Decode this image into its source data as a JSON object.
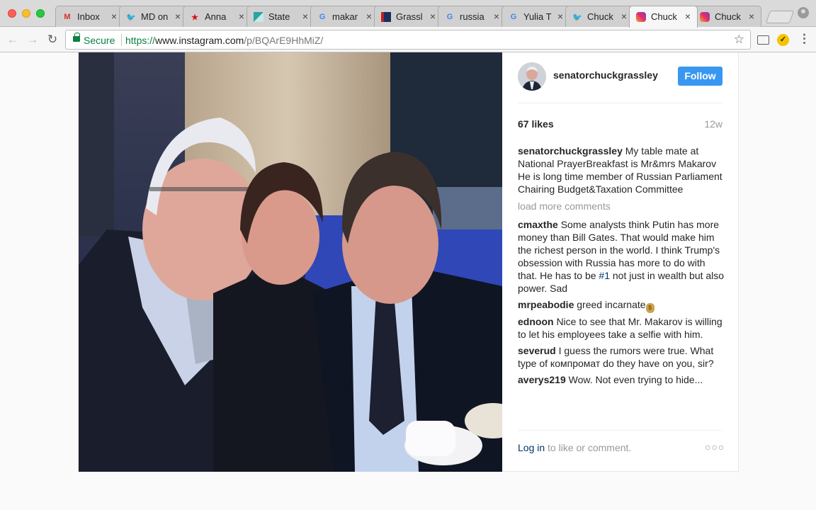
{
  "browser": {
    "tabs": [
      {
        "label": "Inbox",
        "icon": "gmail-icon",
        "active": false
      },
      {
        "label": "MD on",
        "icon": "twitter-icon",
        "active": false
      },
      {
        "label": "Anna",
        "icon": "red-star-icon",
        "active": false
      },
      {
        "label": "State",
        "icon": "state-site-icon",
        "active": false
      },
      {
        "label": "makar",
        "icon": "google-icon",
        "active": false
      },
      {
        "label": "Grassl",
        "icon": "news-site-icon",
        "active": false
      },
      {
        "label": "russia",
        "icon": "google-icon",
        "active": false
      },
      {
        "label": "Yulia T",
        "icon": "google-icon",
        "active": false
      },
      {
        "label": "Chuck",
        "icon": "twitter-icon",
        "active": false
      },
      {
        "label": "Chuck",
        "icon": "instagram-icon",
        "active": true
      },
      {
        "label": "Chuck",
        "icon": "instagram-icon",
        "active": false
      }
    ],
    "secure_label": "Secure",
    "url_scheme": "https://",
    "url_host": "www.instagram.com",
    "url_path": "/p/BQArE9HhMiZ/"
  },
  "post": {
    "username": "senatorchuckgrassley",
    "follow_label": "Follow",
    "likes": "67 likes",
    "age": "12w",
    "caption_user": "senatorchuckgrassley",
    "caption_text": "My table mate at National PrayerBreakfast is Mr&mrs Makarov He is long time member of Russian Parliament Chairing Budget&Taxation Committee",
    "load_more": "load more comments",
    "comments": [
      {
        "user": "cmaxthe",
        "text_before": "Some analysts think Putin has more money than Bill Gates. That would make him the richest person in the world. I think Trump's obsession with Russia has more to do with that. He has to be ",
        "hashtag": "#1",
        "text_after": " not just in wealth but also power. Sad"
      },
      {
        "user": "mrpeabodie",
        "text": "greed incarnate"
      },
      {
        "user": "ednoon",
        "text": "Nice to see that Mr. Makarov is willing to let his employees take a selfie with him."
      },
      {
        "user": "severud",
        "text": "I guess the rumors were true. What type of компромат do they have on you, sir?"
      },
      {
        "user": "averys219",
        "text": "Wow. Not even trying to hide..."
      }
    ],
    "login_link": "Log in",
    "login_rest": " to like or comment.",
    "more_dots": "○○○"
  },
  "colors": {
    "follow_button": "#3897f0",
    "secure_green": "#0b8043",
    "link_blue": "#003569"
  }
}
